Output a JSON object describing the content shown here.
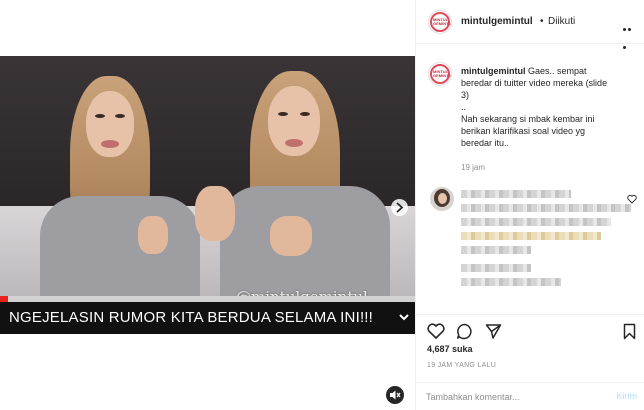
{
  "header": {
    "username": "mintulgemintul",
    "separator": "•",
    "follow_status": "Diikuti"
  },
  "avatar": {
    "label": "MINTUL GEMINTUL"
  },
  "post": {
    "username": "mintulgemintul",
    "caption_first": "Gaes.. sempat",
    "caption_lines": [
      "beredar di tuitter video mereka (slide",
      "3)",
      "..",
      "Nah sekarang si mbak kembar ini",
      "berikan klarifikasi soal video yg",
      "beredar itu.."
    ],
    "time_ago": "19 jam"
  },
  "video": {
    "caption": "NGEJELASIN RUMOR KITA BERDUA SELAMA INI!!!",
    "watermark": "@mintulgemintul",
    "progress": 0.02
  },
  "engagement": {
    "likes_count": "4,687",
    "likes_label": "suka",
    "timestamp": "19 JAM YANG LALU"
  },
  "comment_box": {
    "placeholder": "Tambahkan komentar...",
    "post_label": "Kirim"
  },
  "colors": {
    "accent_blue": "#b2dffc",
    "progress_red": "#e52420",
    "text": "#262626",
    "muted": "#8e8e8e"
  },
  "icons": [
    "chevron-right-icon",
    "mute-icon",
    "more-options-icon",
    "heart-icon",
    "comment-icon",
    "share-icon",
    "bookmark-icon",
    "chevron-down-icon"
  ]
}
